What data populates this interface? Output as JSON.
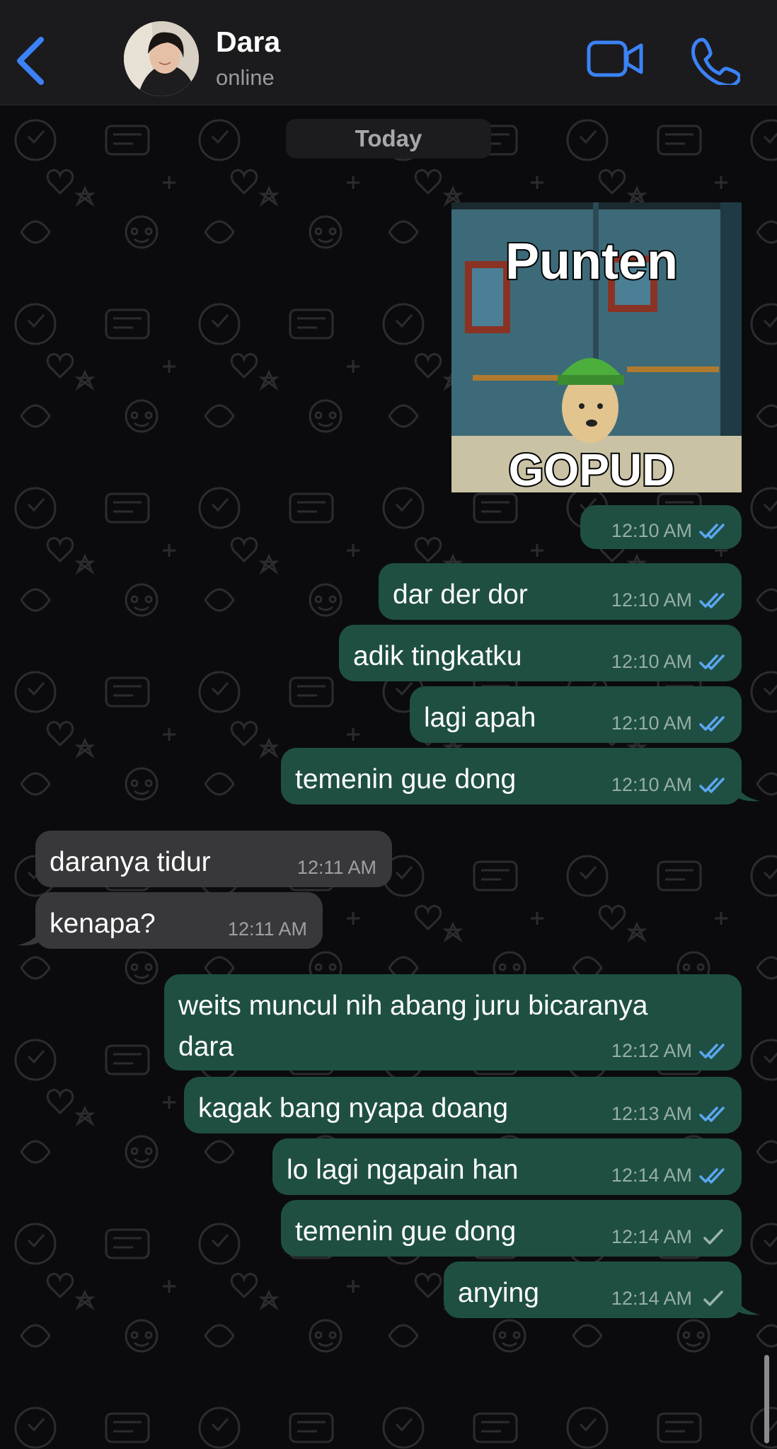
{
  "header": {
    "contact_name": "Dara",
    "contact_status": "online"
  },
  "chat": {
    "date_label": "Today",
    "sticker": {
      "top_text": "Punten",
      "bottom_text": "GOPUD"
    },
    "messages": [
      {
        "direction": "out",
        "text": "",
        "time": "12:10 AM",
        "status": "read"
      },
      {
        "direction": "out",
        "text": "dar der dor",
        "time": "12:10 AM",
        "status": "read"
      },
      {
        "direction": "out",
        "text": "adik tingkatku",
        "time": "12:10 AM",
        "status": "read"
      },
      {
        "direction": "out",
        "text": "lagi apah",
        "time": "12:10 AM",
        "status": "read"
      },
      {
        "direction": "out",
        "text": "temenin gue dong",
        "time": "12:10 AM",
        "status": "read"
      },
      {
        "direction": "in",
        "text": "daranya tidur",
        "time": "12:11 AM"
      },
      {
        "direction": "in",
        "text": "kenapa?",
        "time": "12:11 AM"
      },
      {
        "direction": "out",
        "text": "weits muncul nih abang juru bicaranya\ndara",
        "time": "12:12 AM",
        "status": "read"
      },
      {
        "direction": "out",
        "text": "kagak bang nyapa doang",
        "time": "12:13 AM",
        "status": "read"
      },
      {
        "direction": "out",
        "text": "lo lagi ngapain han",
        "time": "12:14 AM",
        "status": "read"
      },
      {
        "direction": "out",
        "text": "temenin gue dong",
        "time": "12:14 AM",
        "status": "sent"
      },
      {
        "direction": "out",
        "text": "anying",
        "time": "12:14 AM",
        "status": "sent"
      }
    ]
  },
  "colors": {
    "accent": "#3b82f6",
    "outgoing_bubble": "#1f4f43",
    "incoming_bubble": "#38383b",
    "read_tick": "#5aa7f0",
    "sent_tick": "#9bb4ac"
  }
}
